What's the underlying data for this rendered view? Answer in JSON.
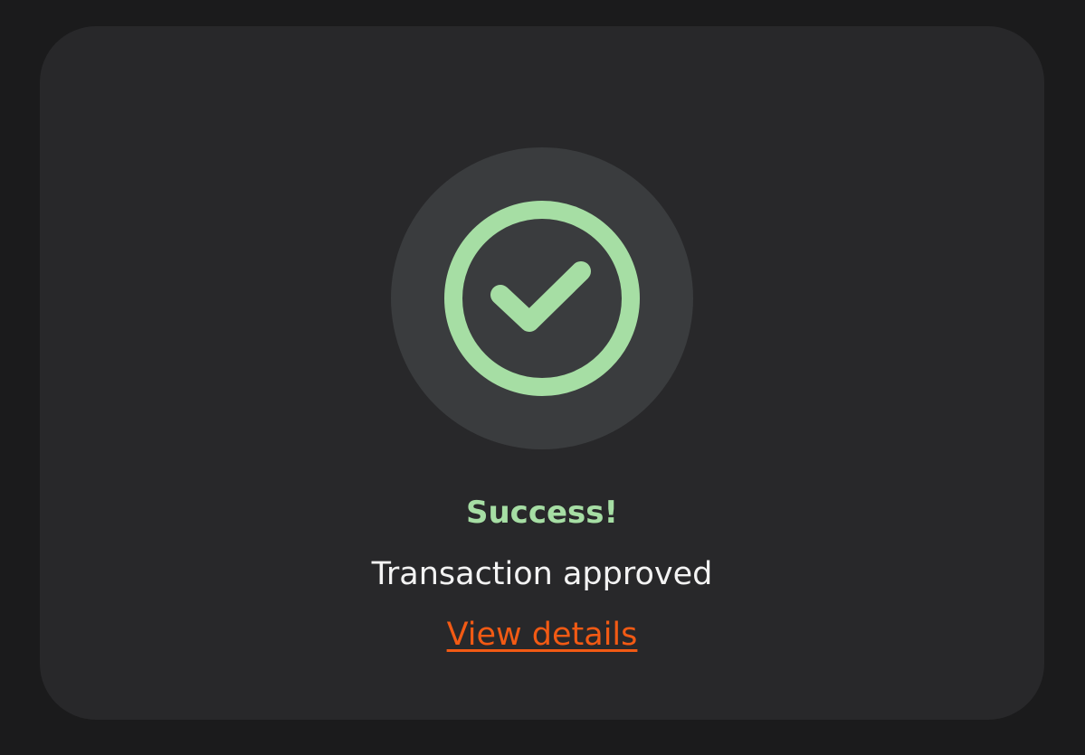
{
  "status": {
    "icon": "check-circle-icon",
    "title": "Success!",
    "message": "Transaction approved",
    "link_label": "View details"
  },
  "colors": {
    "page_background": "#1b1b1c",
    "card_background": "#28282a",
    "icon_background": "#3a3c3e",
    "success": "#a6dea4",
    "text": "#f3f3f3",
    "link": "#f25a14"
  }
}
